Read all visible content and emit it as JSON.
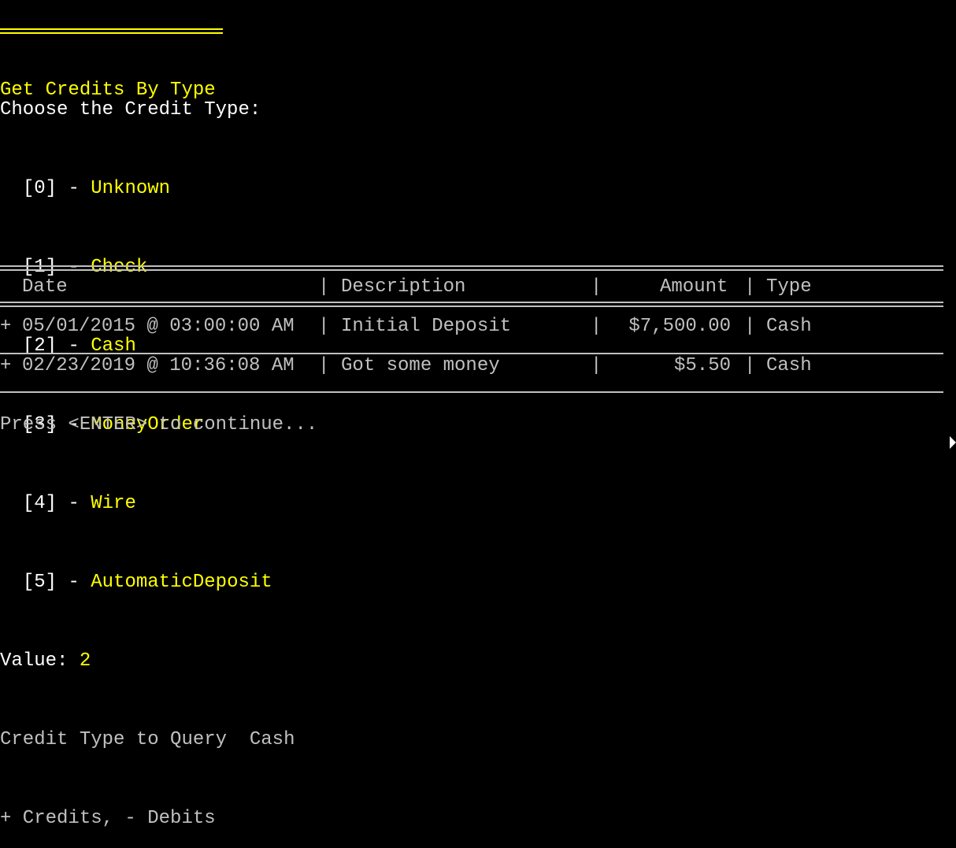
{
  "header": {
    "title": "Get Credits By Type"
  },
  "menu": {
    "prompt": "Choose the Credit Type:",
    "options": [
      {
        "key": "[0]",
        "dash": "-",
        "label": "Unknown"
      },
      {
        "key": "[1]",
        "dash": "-",
        "label": "Check"
      },
      {
        "key": "[2]",
        "dash": "-",
        "label": "Cash"
      },
      {
        "key": "[3]",
        "dash": "-",
        "label": "MoneyOrder"
      },
      {
        "key": "[4]",
        "dash": "-",
        "label": "Wire"
      },
      {
        "key": "[5]",
        "dash": "-",
        "label": "AutomaticDeposit"
      }
    ],
    "value_label": "Value:",
    "value": "2"
  },
  "query": {
    "label": "Credit Type to Query",
    "value": "Cash",
    "legend": "+ Credits, - Debits"
  },
  "table": {
    "columns": [
      "Date",
      "Description",
      "Amount",
      "Type"
    ],
    "separator": "|",
    "rows": [
      {
        "sign": "+",
        "date": "05/01/2015 @ 03:00:00 AM",
        "description": "Initial Deposit",
        "amount": "$7,500.00",
        "type": "Cash"
      },
      {
        "sign": "+",
        "date": "02/23/2019 @ 10:36:08 AM",
        "description": "Got some money",
        "amount": "$5.50",
        "type": "Cash"
      }
    ]
  },
  "footer": {
    "prompt": "Press <ENTER> to continue..."
  },
  "colors": {
    "background": "#000000",
    "text": "#c0c0c0",
    "highlight": "#ffff00",
    "bright": "#ffffff"
  }
}
